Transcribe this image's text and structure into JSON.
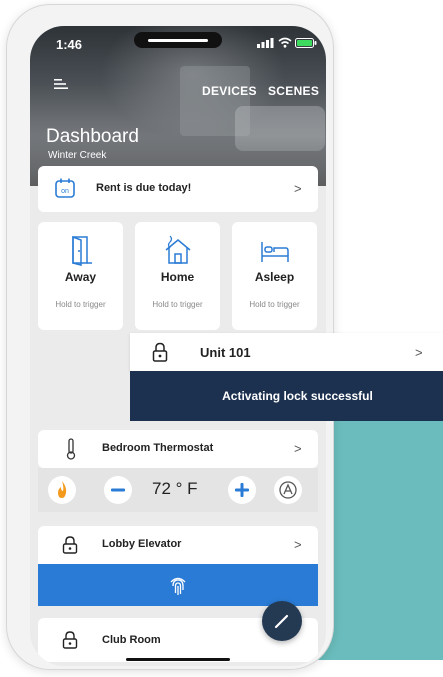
{
  "status_bar": {
    "time": "1:46"
  },
  "header": {
    "nav_devices": "DEVICES",
    "nav_scenes": "SCENES",
    "title": "Dashboard",
    "subtitle": "Winter Creek"
  },
  "rent": {
    "text": "Rent is due today!",
    "icon_label": "on"
  },
  "scenes": [
    {
      "label": "Away",
      "hint": "Hold to trigger",
      "icon": "door-icon"
    },
    {
      "label": "Home",
      "hint": "Hold to trigger",
      "icon": "house-icon"
    },
    {
      "label": "Asleep",
      "hint": "Hold to trigger",
      "icon": "bed-icon"
    }
  ],
  "unit_popup": {
    "label": "Unit 101"
  },
  "toast": {
    "text": "Activating lock successful"
  },
  "thermostat": {
    "label": "Bedroom Thermostat",
    "temperature": "72 ° F"
  },
  "elevator": {
    "label": "Lobby Elevator"
  },
  "club_room": {
    "label": "Club Room"
  },
  "chevron": ">",
  "colors": {
    "accent_blue": "#2a7bd5",
    "toast_navy": "#1c3150",
    "teal_backdrop": "#6bbdbd",
    "flame_orange": "#f39a1c",
    "fab_navy": "#243a53"
  }
}
